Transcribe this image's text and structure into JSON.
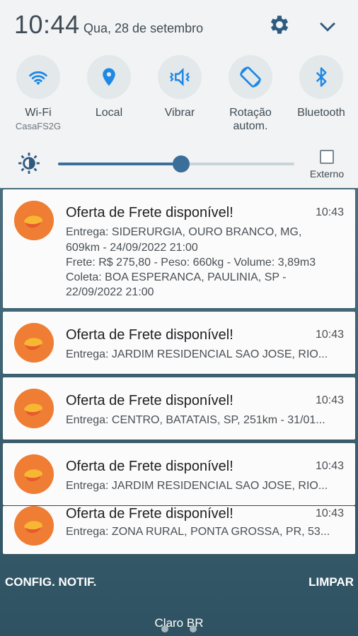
{
  "status": {
    "time": "10:44",
    "date": "Qua, 28 de setembro"
  },
  "quick_settings": [
    {
      "label": "Wi-Fi",
      "sub": "CasaFS2G",
      "icon": "wifi-icon"
    },
    {
      "label": "Local",
      "sub": "",
      "icon": "location-icon"
    },
    {
      "label": "Vibrar",
      "sub": "",
      "icon": "vibrate-icon"
    },
    {
      "label": "Rotação autom.",
      "sub": "",
      "icon": "rotation-icon"
    },
    {
      "label": "Bluetooth",
      "sub": "",
      "icon": "bluetooth-icon"
    }
  ],
  "brightness": {
    "level_percent": 52,
    "external_label": "Externo",
    "external_checked": false
  },
  "notifications": [
    {
      "title": "Oferta de Frete disponível!",
      "time": "10:43",
      "lines": [
        "Entrega: SIDERURGIA, OURO BRANCO, MG,",
        "609km - 24/09/2022 21:00",
        "Frete: R$ 275,80 - Peso: 660kg - Volume: 3,89m3",
        "Coleta: BOA ESPERANCA, PAULINIA, SP -",
        "22/09/2022 21:00"
      ]
    },
    {
      "title": "Oferta de Frete disponível!",
      "time": "10:43",
      "lines": [
        "Entrega: JARDIM RESIDENCIAL SAO JOSE, RIO..."
      ]
    },
    {
      "title": "Oferta de Frete disponível!",
      "time": "10:43",
      "lines": [
        "Entrega: CENTRO, BATATAIS, SP, 251km - 31/01..."
      ]
    },
    {
      "title": "Oferta de Frete disponível!",
      "time": "10:43",
      "lines": [
        "Entrega: JARDIM RESIDENCIAL SAO JOSE, RIO..."
      ]
    },
    {
      "title": "Oferta de Frete disponível!",
      "time": "10:43",
      "lines": [
        "Entrega: ZONA RURAL, PONTA GROSSA, PR, 53..."
      ]
    }
  ],
  "footer": {
    "config": "CONFIG. NOTIF.",
    "clear": "LIMPAR",
    "carrier": "Claro BR"
  },
  "colors": {
    "accent": "#3b6e99",
    "app_icon": "#ef7d33"
  }
}
